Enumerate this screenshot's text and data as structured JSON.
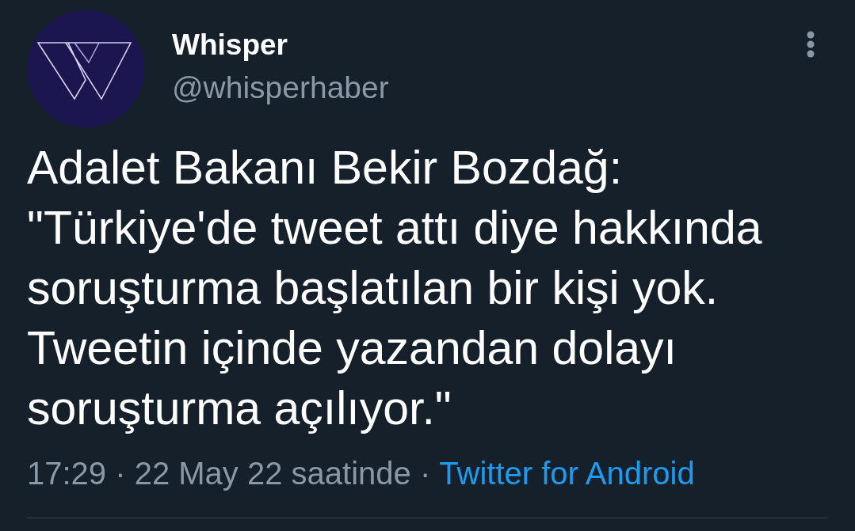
{
  "author": {
    "name": "Whisper",
    "handle": "@whisperhaber"
  },
  "tweet": {
    "lines": [
      "Adalet Bakanı Bekir Bozdağ:",
      "\"Türkiye'de tweet attı diye hakkında",
      "soruşturma başlatılan bir kişi yok.",
      "Tweetin içinde yazandan dolayı",
      "soruşturma açılıyor.\""
    ]
  },
  "meta": {
    "time": "17:29",
    "separator": "·",
    "date": "22 May 22 saatinde",
    "source": "Twitter for Android"
  }
}
